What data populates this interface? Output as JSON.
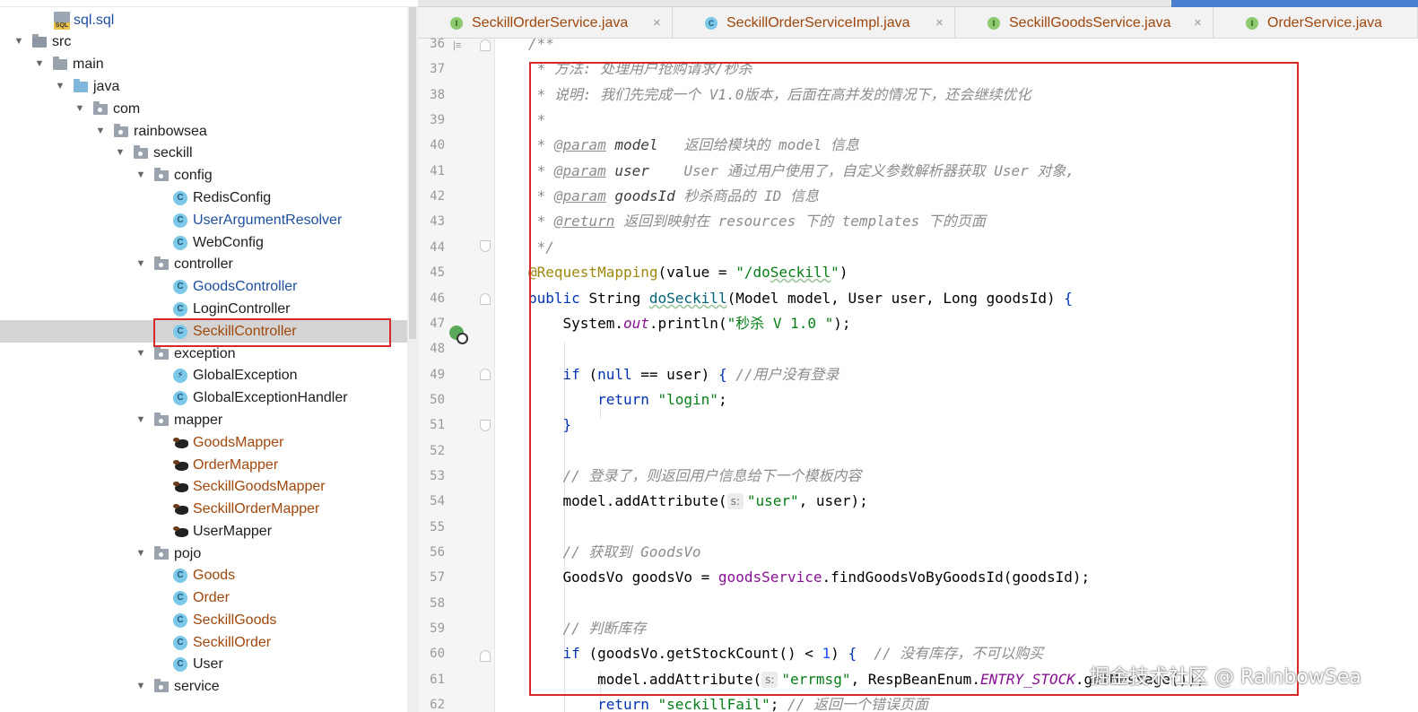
{
  "project_tree": {
    "items": [
      {
        "label": "sql.sql",
        "depth": 3,
        "kind": "sql",
        "color": "blue",
        "expand": ""
      },
      {
        "label": "src",
        "depth": 0,
        "kind": "folder-src",
        "color": "",
        "expand": "▼"
      },
      {
        "label": "main",
        "depth": 1,
        "kind": "folder",
        "color": "",
        "expand": "▼"
      },
      {
        "label": "java",
        "depth": 2,
        "kind": "folder-java",
        "color": "",
        "expand": "▼"
      },
      {
        "label": "com",
        "depth": 3,
        "kind": "package",
        "color": "",
        "expand": "▼"
      },
      {
        "label": "rainbowsea",
        "depth": 4,
        "kind": "package",
        "color": "",
        "expand": "▼"
      },
      {
        "label": "seckill",
        "depth": 5,
        "kind": "package",
        "color": "",
        "expand": "▼"
      },
      {
        "label": "config",
        "depth": 6,
        "kind": "package",
        "color": "",
        "expand": "▼"
      },
      {
        "label": "RedisConfig",
        "depth": 7,
        "kind": "class",
        "color": "",
        "expand": ""
      },
      {
        "label": "UserArgumentResolver",
        "depth": 7,
        "kind": "class",
        "color": "blue",
        "expand": ""
      },
      {
        "label": "WebConfig",
        "depth": 7,
        "kind": "class",
        "color": "",
        "expand": ""
      },
      {
        "label": "controller",
        "depth": 6,
        "kind": "package",
        "color": "",
        "expand": "▼"
      },
      {
        "label": "GoodsController",
        "depth": 7,
        "kind": "class",
        "color": "blue",
        "expand": ""
      },
      {
        "label": "LoginController",
        "depth": 7,
        "kind": "class",
        "color": "",
        "expand": ""
      },
      {
        "label": "SeckillController",
        "depth": 7,
        "kind": "class",
        "color": "brown",
        "expand": "",
        "selected": true
      },
      {
        "label": "exception",
        "depth": 6,
        "kind": "package",
        "color": "",
        "expand": "▼"
      },
      {
        "label": "GlobalException",
        "depth": 7,
        "kind": "exception",
        "color": "",
        "expand": ""
      },
      {
        "label": "GlobalExceptionHandler",
        "depth": 7,
        "kind": "class",
        "color": "",
        "expand": ""
      },
      {
        "label": "mapper",
        "depth": 6,
        "kind": "package",
        "color": "",
        "expand": "▼"
      },
      {
        "label": "GoodsMapper",
        "depth": 7,
        "kind": "mybatis",
        "color": "brown",
        "expand": ""
      },
      {
        "label": "OrderMapper",
        "depth": 7,
        "kind": "mybatis",
        "color": "brown",
        "expand": ""
      },
      {
        "label": "SeckillGoodsMapper",
        "depth": 7,
        "kind": "mybatis",
        "color": "brown",
        "expand": ""
      },
      {
        "label": "SeckillOrderMapper",
        "depth": 7,
        "kind": "mybatis",
        "color": "brown",
        "expand": ""
      },
      {
        "label": "UserMapper",
        "depth": 7,
        "kind": "mybatis",
        "color": "",
        "expand": ""
      },
      {
        "label": "pojo",
        "depth": 6,
        "kind": "package",
        "color": "",
        "expand": "▼"
      },
      {
        "label": "Goods",
        "depth": 7,
        "kind": "class",
        "color": "brown",
        "expand": ""
      },
      {
        "label": "Order",
        "depth": 7,
        "kind": "class",
        "color": "brown",
        "expand": ""
      },
      {
        "label": "SeckillGoods",
        "depth": 7,
        "kind": "class",
        "color": "brown",
        "expand": ""
      },
      {
        "label": "SeckillOrder",
        "depth": 7,
        "kind": "class",
        "color": "brown",
        "expand": ""
      },
      {
        "label": "User",
        "depth": 7,
        "kind": "class",
        "color": "",
        "expand": ""
      },
      {
        "label": "service",
        "depth": 6,
        "kind": "package",
        "color": "",
        "expand": "▼"
      }
    ]
  },
  "tabs": [
    {
      "label": "SeckillOrderService.java",
      "icon": "I",
      "kind": "interface"
    },
    {
      "label": "SeckillOrderServiceImpl.java",
      "icon": "C",
      "kind": "class"
    },
    {
      "label": "SeckillGoodsService.java",
      "icon": "I",
      "kind": "interface"
    },
    {
      "label": "OrderService.java",
      "icon": "I",
      "kind": "interface"
    }
  ],
  "tab_close_glyph": "×",
  "editor": {
    "lines": [
      {
        "n": "36",
        "segs": [
          [
            "cm",
            "/**"
          ]
        ]
      },
      {
        "n": "37",
        "segs": [
          [
            "cm",
            " * 方法: 处理用户抢购请求/秒杀"
          ]
        ]
      },
      {
        "n": "38",
        "segs": [
          [
            "cm",
            " * 说明: 我们先完成一个 V1.0版本，后面在高并发的情况下，还会继续优化"
          ]
        ]
      },
      {
        "n": "39",
        "segs": [
          [
            "cm",
            " *"
          ]
        ]
      },
      {
        "n": "40",
        "segs": [
          [
            "cm",
            " * "
          ],
          [
            "tag",
            "@param"
          ],
          [
            "cm",
            " "
          ],
          [
            "tagv",
            "model"
          ],
          [
            "cm",
            "   返回给模块的 model 信息"
          ]
        ]
      },
      {
        "n": "41",
        "segs": [
          [
            "cm",
            " * "
          ],
          [
            "tag",
            "@param"
          ],
          [
            "cm",
            " "
          ],
          [
            "tagv",
            "user"
          ],
          [
            "cm",
            "    User 通过用户使用了，自定义参数解析器获取 User 对象,"
          ]
        ]
      },
      {
        "n": "42",
        "segs": [
          [
            "cm",
            " * "
          ],
          [
            "tag",
            "@param"
          ],
          [
            "cm",
            " "
          ],
          [
            "tagv",
            "goodsId"
          ],
          [
            "cm",
            " 秒杀商品的 ID 信息"
          ]
        ]
      },
      {
        "n": "43",
        "segs": [
          [
            "cm",
            " * "
          ],
          [
            "tag",
            "@return"
          ],
          [
            "cm",
            " 返回到映射在 resources 下的 templates 下的页面"
          ]
        ]
      },
      {
        "n": "44",
        "segs": [
          [
            "cm",
            " */"
          ]
        ]
      },
      {
        "n": "45",
        "segs": [
          [
            "an",
            "@RequestMapping"
          ],
          [
            "",
            "(value = "
          ],
          [
            "st",
            "\"/do"
          ],
          [
            "stw",
            "Seckill"
          ],
          [
            "st",
            "\""
          ],
          [
            "",
            ")"
          ]
        ]
      },
      {
        "n": "46",
        "segs": [
          [
            "kw",
            "public "
          ],
          [
            "",
            "String "
          ],
          [
            "fnw",
            "doSeckill"
          ],
          [
            "",
            "(Model model, User user, Long goodsId) "
          ],
          [
            "kw",
            "{"
          ]
        ]
      },
      {
        "n": "47",
        "segs": [
          [
            "",
            "    System."
          ],
          [
            "sf",
            "out"
          ],
          [
            "",
            ".println("
          ],
          [
            "st",
            "\"秒杀 V 1.0 \""
          ],
          [
            "",
            ");"
          ]
        ]
      },
      {
        "n": "48",
        "segs": [
          [
            "",
            ""
          ]
        ]
      },
      {
        "n": "49",
        "segs": [
          [
            "",
            "    "
          ],
          [
            "kw",
            "if "
          ],
          [
            "",
            "("
          ],
          [
            "kw",
            "null"
          ],
          [
            "",
            " == user) "
          ],
          [
            "kw",
            "{ "
          ],
          [
            "cm",
            "//用户没有登录"
          ]
        ]
      },
      {
        "n": "50",
        "segs": [
          [
            "",
            "        "
          ],
          [
            "kw",
            "return "
          ],
          [
            "st",
            "\"login\""
          ],
          [
            "",
            ";"
          ]
        ]
      },
      {
        "n": "51",
        "segs": [
          [
            "",
            "    "
          ],
          [
            "kw",
            "}"
          ]
        ]
      },
      {
        "n": "52",
        "segs": [
          [
            "",
            ""
          ]
        ]
      },
      {
        "n": "53",
        "segs": [
          [
            "",
            "    "
          ],
          [
            "cm",
            "// 登录了，则返回用户信息给下一个模板内容"
          ]
        ]
      },
      {
        "n": "54",
        "segs": [
          [
            "",
            "    model.addAttribute("
          ],
          [
            "hint",
            "s:"
          ],
          [
            "st",
            "\"user\""
          ],
          [
            "",
            ", user);"
          ]
        ]
      },
      {
        "n": "55",
        "segs": [
          [
            "",
            ""
          ]
        ]
      },
      {
        "n": "56",
        "segs": [
          [
            "",
            "    "
          ],
          [
            "cm",
            "// 获取到 GoodsVo"
          ]
        ]
      },
      {
        "n": "57",
        "segs": [
          [
            "",
            "    GoodsVo goodsVo = "
          ],
          [
            "fd",
            "goodsService"
          ],
          [
            "",
            ".findGoodsVoByGoodsId(goodsId);"
          ]
        ]
      },
      {
        "n": "58",
        "segs": [
          [
            "",
            ""
          ]
        ]
      },
      {
        "n": "59",
        "segs": [
          [
            "",
            "    "
          ],
          [
            "cm",
            "// 判断库存"
          ]
        ]
      },
      {
        "n": "60",
        "segs": [
          [
            "",
            "    "
          ],
          [
            "kw",
            "if "
          ],
          [
            "",
            "(goodsVo.getStockCount() < "
          ],
          [
            "num",
            "1"
          ],
          [
            "",
            ") "
          ],
          [
            "kw",
            "{ "
          ],
          [
            "cm",
            " // 没有库存，不可以购买"
          ]
        ]
      },
      {
        "n": "61",
        "segs": [
          [
            "",
            "        model.addAttribute("
          ],
          [
            "hint",
            "s:"
          ],
          [
            "st",
            "\"errmsg\""
          ],
          [
            "",
            ", RespBeanEnum."
          ],
          [
            "sf",
            "ENTRY_STOCK"
          ],
          [
            "",
            ".getMessage());"
          ]
        ]
      },
      {
        "n": "62",
        "segs": [
          [
            "",
            "        "
          ],
          [
            "kw",
            "return "
          ],
          [
            "st",
            "\"seckillFail\""
          ],
          [
            "",
            "; "
          ],
          [
            "cm",
            "// 返回一个错误页面"
          ]
        ]
      }
    ]
  },
  "watermark": "掘金技术社区 @ RainbowSea",
  "colors": {
    "highlight_box": "#d62a2a",
    "selection": "#d4d4d4",
    "tab_active_bar": "#4a7fd0"
  }
}
